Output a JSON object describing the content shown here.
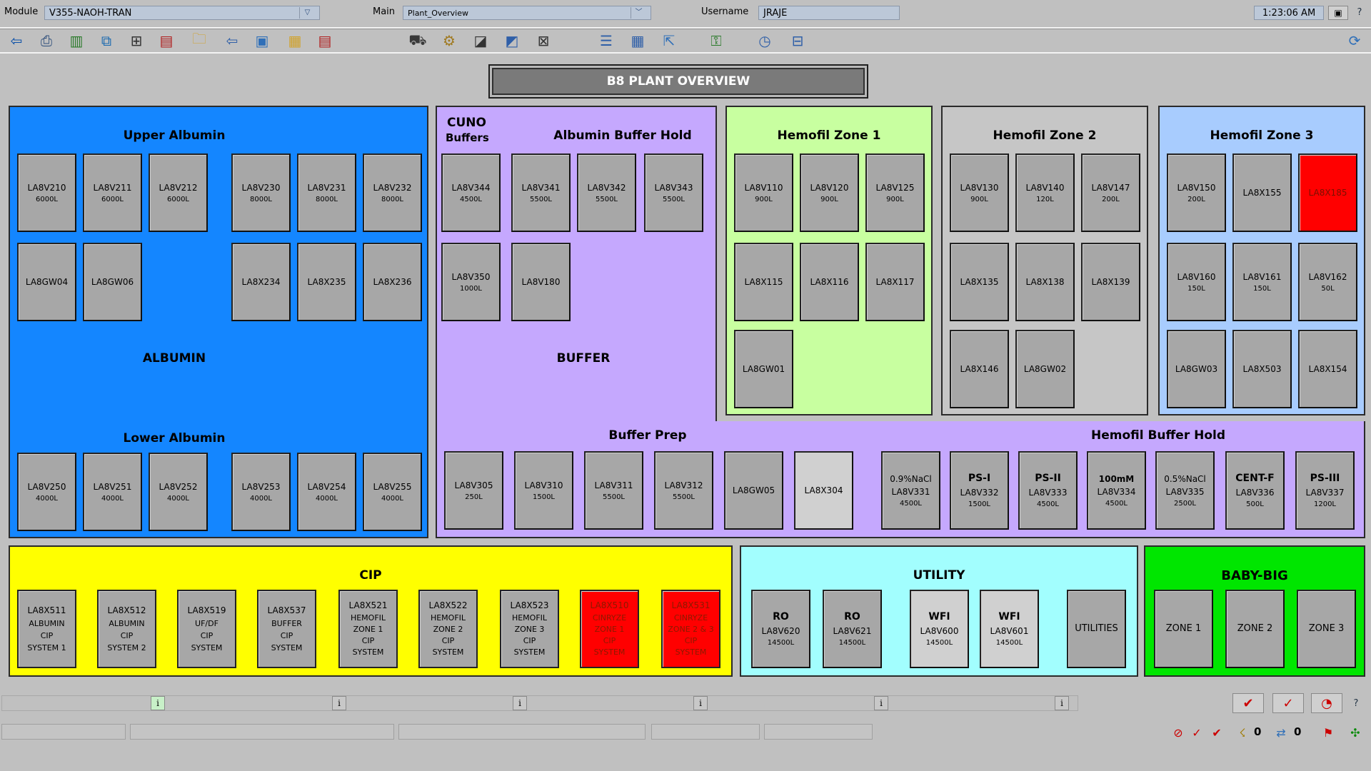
{
  "header": {
    "module_label": "Module",
    "module_value": "V355-NAOH-TRAN",
    "main_label": "Main",
    "main_value": "Plant_Overview",
    "username_label": "Username",
    "username_value": "JRAJE",
    "time": "1:23:06 AM",
    "help": "?"
  },
  "title": "B8 PLANT OVERVIEW",
  "albumin": {
    "label": "ALBUMIN",
    "upper": {
      "title": "Upper Albumin",
      "tiles": [
        {
          "id": "LA8V210",
          "cap": "6000L"
        },
        {
          "id": "LA8V211",
          "cap": "6000L"
        },
        {
          "id": "LA8V212",
          "cap": "6000L"
        },
        {
          "id": "LA8V230",
          "cap": "8000L"
        },
        {
          "id": "LA8V231",
          "cap": "8000L"
        },
        {
          "id": "LA8V232",
          "cap": "8000L"
        },
        {
          "id": "LA8GW04",
          "cap": ""
        },
        {
          "id": "LA8GW06",
          "cap": ""
        },
        {
          "id": "LA8X234",
          "cap": ""
        },
        {
          "id": "LA8X235",
          "cap": ""
        },
        {
          "id": "LA8X236",
          "cap": ""
        }
      ]
    },
    "lower": {
      "title": "Lower Albumin",
      "tiles": [
        {
          "id": "LA8V250",
          "cap": "4000L"
        },
        {
          "id": "LA8V251",
          "cap": "4000L"
        },
        {
          "id": "LA8V252",
          "cap": "4000L"
        },
        {
          "id": "LA8V253",
          "cap": "4000L"
        },
        {
          "id": "LA8V254",
          "cap": "4000L"
        },
        {
          "id": "LA8V255",
          "cap": "4000L"
        }
      ]
    }
  },
  "buffer": {
    "label": "BUFFER",
    "cuno": "CUNO",
    "cuno2": "Buffers",
    "hold_title": "Albumin Buffer Hold",
    "tiles": [
      {
        "id": "LA8V344",
        "cap": "4500L"
      },
      {
        "id": "LA8V341",
        "cap": "5500L"
      },
      {
        "id": "LA8V342",
        "cap": "5500L"
      },
      {
        "id": "LA8V343",
        "cap": "5500L"
      },
      {
        "id": "LA8V350",
        "cap": "1000L"
      },
      {
        "id": "LA8V180",
        "cap": ""
      }
    ],
    "prep_title": "Buffer Prep",
    "prep_tiles": [
      {
        "id": "LA8V305",
        "cap": "250L"
      },
      {
        "id": "LA8V310",
        "cap": "1500L"
      },
      {
        "id": "LA8V311",
        "cap": "5500L"
      },
      {
        "id": "LA8V312",
        "cap": "5500L"
      },
      {
        "id": "LA8GW05",
        "cap": ""
      },
      {
        "id": "LA8X304",
        "cap": ""
      }
    ],
    "hfhold_title": "Hemofil Buffer Hold",
    "hfhold_tiles": [
      {
        "top": "0.9%NaCl",
        "id": "LA8V331",
        "cap": "4500L"
      },
      {
        "top": "PS-I",
        "id": "LA8V332",
        "cap": "1500L"
      },
      {
        "top": "PS-II",
        "id": "LA8V333",
        "cap": "4500L"
      },
      {
        "top": "100mM",
        "id": "LA8V334",
        "cap": "4500L"
      },
      {
        "top": "0.5%NaCl",
        "id": "LA8V335",
        "cap": "2500L"
      },
      {
        "top": "CENT-F",
        "id": "LA8V336",
        "cap": "500L"
      },
      {
        "top": "PS-III",
        "id": "LA8V337",
        "cap": "1200L"
      }
    ]
  },
  "hz1": {
    "title": "Hemofil Zone 1",
    "tiles": [
      {
        "id": "LA8V110",
        "cap": "900L"
      },
      {
        "id": "LA8V120",
        "cap": "900L"
      },
      {
        "id": "LA8V125",
        "cap": "900L"
      },
      {
        "id": "LA8X115",
        "cap": ""
      },
      {
        "id": "LA8X116",
        "cap": ""
      },
      {
        "id": "LA8X117",
        "cap": ""
      },
      {
        "id": "LA8GW01",
        "cap": ""
      }
    ]
  },
  "hz2": {
    "title": "Hemofil Zone 2",
    "tiles": [
      {
        "id": "LA8V130",
        "cap": "900L"
      },
      {
        "id": "LA8V140",
        "cap": "120L"
      },
      {
        "id": "LA8V147",
        "cap": "200L"
      },
      {
        "id": "LA8X135",
        "cap": ""
      },
      {
        "id": "LA8X138",
        "cap": ""
      },
      {
        "id": "LA8X139",
        "cap": ""
      },
      {
        "id": "LA8X146",
        "cap": ""
      },
      {
        "id": "LA8GW02",
        "cap": ""
      }
    ]
  },
  "hz3": {
    "title": "Hemofil Zone 3",
    "tiles": [
      {
        "id": "LA8V150",
        "cap": "200L"
      },
      {
        "id": "LA8X155",
        "cap": ""
      },
      {
        "id": "LA8X185",
        "cap": ""
      },
      {
        "id": "LA8V160",
        "cap": "150L"
      },
      {
        "id": "LA8V161",
        "cap": "150L"
      },
      {
        "id": "LA8V162",
        "cap": "50L"
      },
      {
        "id": "LA8GW03",
        "cap": ""
      },
      {
        "id": "LA8X503",
        "cap": ""
      },
      {
        "id": "LA8X154",
        "cap": ""
      }
    ]
  },
  "cip": {
    "title": "CIP",
    "tiles": [
      {
        "l1": "LA8X511",
        "l2": "ALBUMIN",
        "l3": "CIP",
        "l4": "SYSTEM 1"
      },
      {
        "l1": "LA8X512",
        "l2": "ALBUMIN",
        "l3": "CIP",
        "l4": "SYSTEM 2"
      },
      {
        "l1": "LA8X519",
        "l2": "UF/DF",
        "l3": "CIP",
        "l4": "SYSTEM"
      },
      {
        "l1": "LA8X537",
        "l2": "BUFFER",
        "l3": "CIP",
        "l4": "SYSTEM"
      },
      {
        "l1": "LA8X521",
        "l2": "HEMOFIL",
        "l3": "ZONE 1",
        "l4": "CIP",
        "l5": "SYSTEM"
      },
      {
        "l1": "LA8X522",
        "l2": "HEMOFIL",
        "l3": "ZONE 2",
        "l4": "CIP",
        "l5": "SYSTEM"
      },
      {
        "l1": "LA8X523",
        "l2": "HEMOFIL",
        "l3": "ZONE 3",
        "l4": "CIP",
        "l5": "SYSTEM"
      },
      {
        "l1": "LA8X510",
        "l2": "CINRYZE",
        "l3": "ZONE 1",
        "l4": "CIP",
        "l5": "SYSTEM"
      },
      {
        "l1": "LA8X531",
        "l2": "CINRYZE",
        "l3": "ZONE 2 & 3",
        "l4": "CIP",
        "l5": "SYSTEM"
      }
    ]
  },
  "utility": {
    "title": "UTILITY",
    "tiles": [
      {
        "top": "RO",
        "id": "LA8V620",
        "cap": "14500L"
      },
      {
        "top": "RO",
        "id": "LA8V621",
        "cap": "14500L"
      },
      {
        "top": "WFI",
        "id": "LA8V600",
        "cap": "14500L"
      },
      {
        "top": "WFI",
        "id": "LA8V601",
        "cap": "14500L"
      }
    ],
    "utilities_label": "UTILITIES"
  },
  "babybig": {
    "title": "BABY-BIG",
    "zones": [
      "ZONE 1",
      "ZONE 2",
      "ZONE 3"
    ]
  },
  "status": {
    "info": "i",
    "count1": "0",
    "count2": "0",
    "help": "?"
  },
  "colors": {
    "albumin": "#1486ff",
    "buffer": "#c5a8fe",
    "hz1": "#c8ffa0",
    "hz2": "#c6c6c6",
    "hz3": "#a8ccfe",
    "cip": "#ffff00",
    "utility": "#a2fefe",
    "babybig": "#00e600",
    "alarm": "#ff0000"
  }
}
